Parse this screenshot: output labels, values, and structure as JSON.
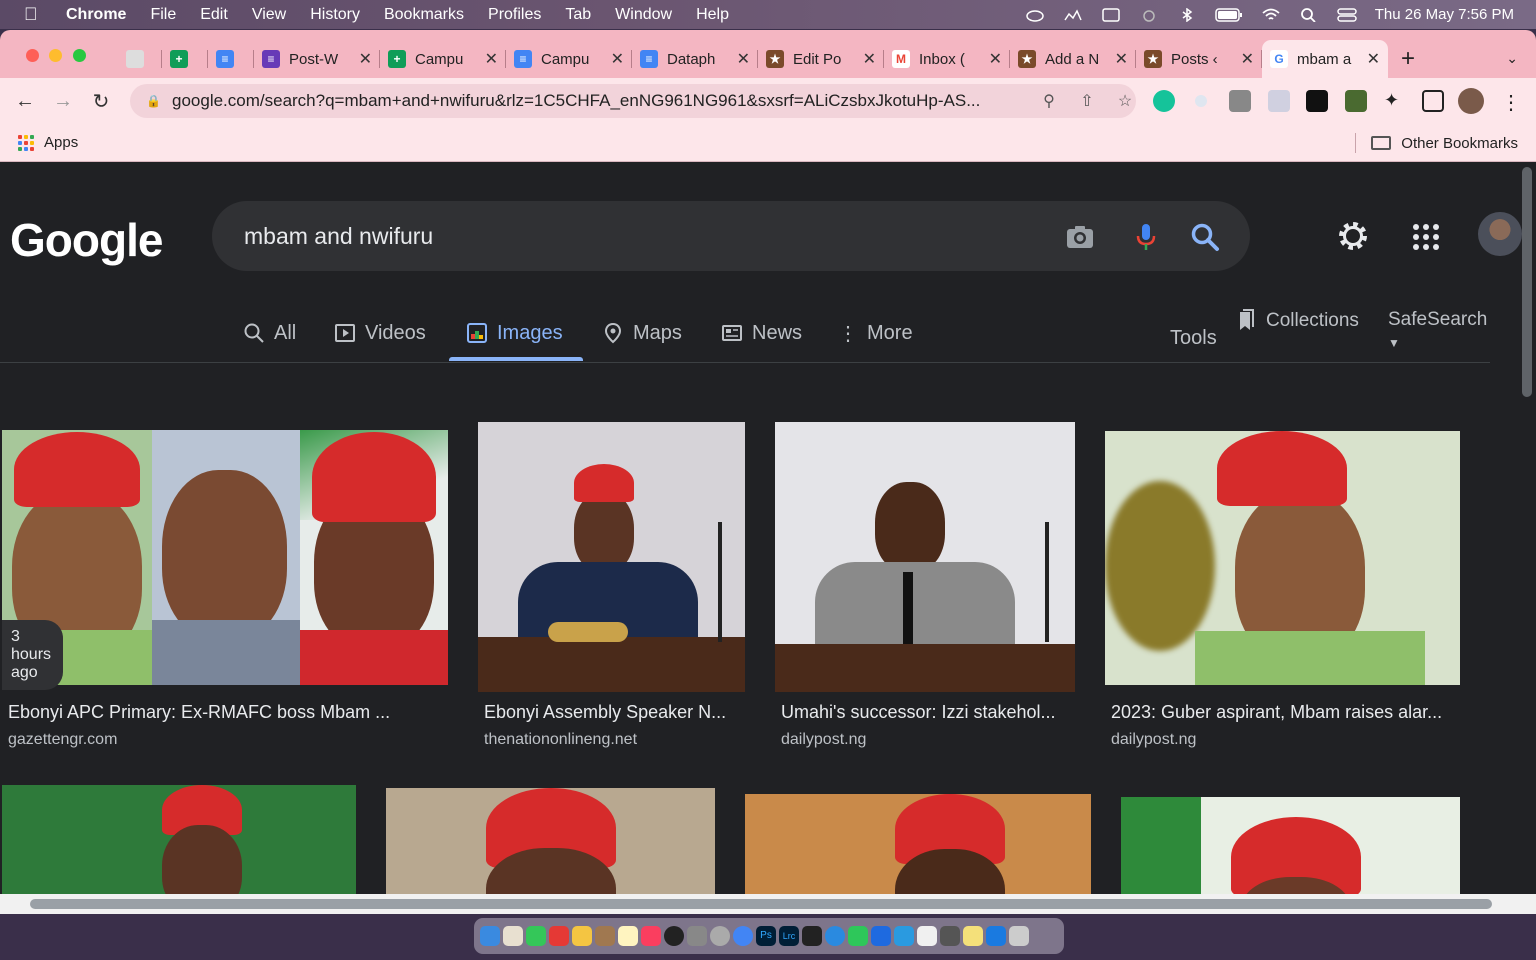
{
  "menubar": {
    "app": "Chrome",
    "items": [
      "File",
      "Edit",
      "View",
      "History",
      "Bookmarks",
      "Profiles",
      "Tab",
      "Window",
      "Help"
    ],
    "datetime": "Thu 26 May  7:56 PM"
  },
  "tabs": [
    {
      "title": "",
      "icon": "doc-icon",
      "color": "#e8e8e8"
    },
    {
      "title": "",
      "icon": "sheets-icon",
      "color": "#0f9d58"
    },
    {
      "title": "",
      "icon": "docs-icon",
      "color": "#4285f4"
    },
    {
      "title": "Post-W",
      "icon": "forms-icon",
      "color": "#673ab7"
    },
    {
      "title": "Campu",
      "icon": "sheets-icon",
      "color": "#0f9d58"
    },
    {
      "title": "Campu",
      "icon": "docs-icon",
      "color": "#4285f4"
    },
    {
      "title": "Dataph",
      "icon": "docs-icon",
      "color": "#4285f4"
    },
    {
      "title": "Edit Po",
      "icon": "site-icon",
      "color": "#7a4a2a"
    },
    {
      "title": "Inbox (",
      "icon": "gmail-icon",
      "color": "#ea4335"
    },
    {
      "title": "Add a N",
      "icon": "site-icon",
      "color": "#7a4a2a"
    },
    {
      "title": "Posts ‹",
      "icon": "site-icon",
      "color": "#7a4a2a"
    },
    {
      "title": "mbam a",
      "icon": "google-icon",
      "color": "#4285f4",
      "active": true
    }
  ],
  "omnibox": {
    "url": "google.com/search?q=mbam+and+nwifuru&rlz=1C5CHFA_enNG961NG961&sxsrf=ALiCzsbxJkotuHp-AS..."
  },
  "bookmarks": {
    "apps_label": "Apps",
    "other_label": "Other Bookmarks"
  },
  "search": {
    "logo": "Google",
    "query": "mbam and nwifuru"
  },
  "nav": {
    "all": "All",
    "videos": "Videos",
    "images": "Images",
    "maps": "Maps",
    "news": "News",
    "more": "More",
    "tools": "Tools",
    "collections": "Collections",
    "safesearch": "SafeSearch"
  },
  "results": [
    {
      "title": "Ebonyi APC Primary: Ex-RMAFC boss Mbam ...",
      "source": "gazettengr.com",
      "badge": "3 hours ago"
    },
    {
      "title": "Ebonyi Assembly Speaker N...",
      "source": "thenationonlineng.net"
    },
    {
      "title": "Umahi's successor: Izzi stakehol...",
      "source": "dailypost.ng"
    },
    {
      "title": "2023: Guber aspirant, Mbam raises alar...",
      "source": "dailypost.ng"
    }
  ],
  "colors": {
    "accent": "#8ab4f8",
    "page_bg": "#202124",
    "tab_strip": "#f4b6c2"
  }
}
